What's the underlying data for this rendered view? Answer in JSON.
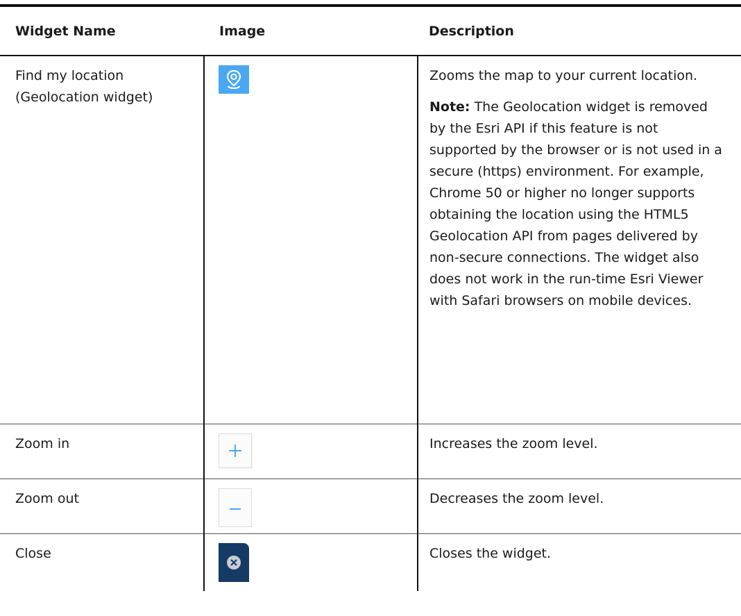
{
  "table": {
    "headers": {
      "widget_name": "Widget Name",
      "image": "Image",
      "description": "Description"
    },
    "rows": [
      {
        "name_line1": "Find my location",
        "name_line2": "(Geolocation widget)",
        "image_icon": "geolocation-pin-icon",
        "description": "Zooms the map to your current location.",
        "note_label": "Note:",
        "note_text": " The Geolocation widget is removed by the Esri API if this feature is not supported by the browser or is not used in a secure (https) environment. For example, Chrome 50 or higher no longer supports obtaining the location using the HTML5 Geolocation API from pages delivered by non-secure connections. The widget also does not work in the run-time Esri Viewer with Safari browsers on mobile devices."
      },
      {
        "name": "Zoom in",
        "image_icon": "plus-icon",
        "description": "Increases the zoom level."
      },
      {
        "name": "Zoom out",
        "image_icon": "minus-icon",
        "description": "Decreases the zoom level."
      },
      {
        "name": "Close",
        "image_icon": "close-icon",
        "description": "Closes the widget."
      }
    ]
  },
  "colors": {
    "geolocation_bg": "#4aa8f2",
    "zoom_icon": "#4aa8f2",
    "close_bg": "#153a63",
    "close_circle": "#c9cdd2"
  }
}
